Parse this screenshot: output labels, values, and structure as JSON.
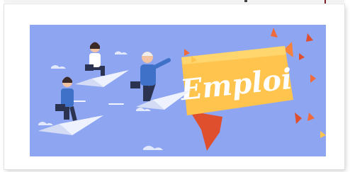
{
  "illustration": {
    "banner_text": "Emploi"
  },
  "colors": {
    "background": "#8ea5f2",
    "banner_front": "#ffc44d",
    "banner_back": "#f06a3c",
    "banner_dark": "#e04f2d",
    "plane": "#f6f8ff",
    "plane_shadow": "#d4dcf5",
    "cloud": "#dfe6fb"
  }
}
